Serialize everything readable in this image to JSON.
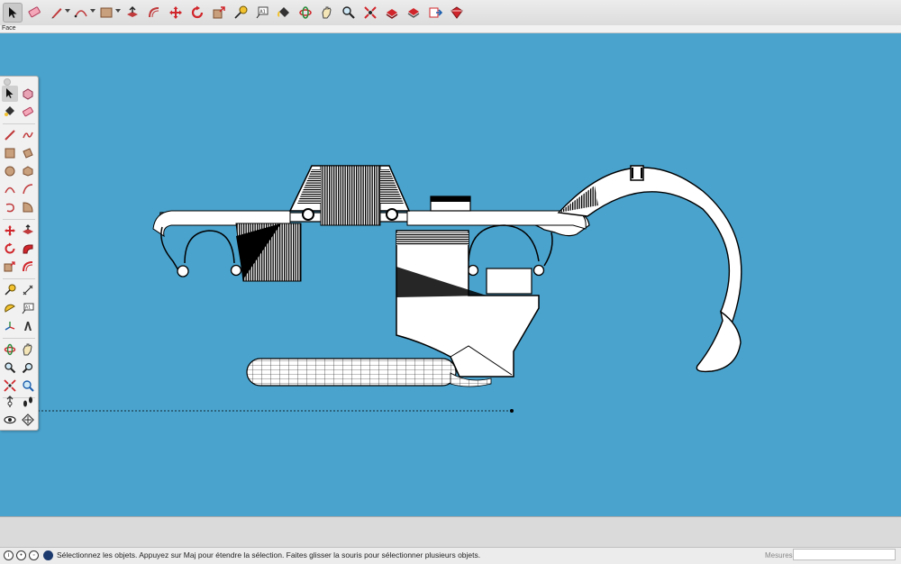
{
  "scene": {
    "tab_label": "Face"
  },
  "toolbar": {
    "buttons": [
      {
        "name": "select-icon",
        "active": true
      },
      {
        "name": "eraser-icon"
      },
      {
        "name": "pencil-icon",
        "dropdown": true
      },
      {
        "name": "arc-icon",
        "dropdown": true
      },
      {
        "name": "rectangle-icon",
        "dropdown": true
      },
      {
        "name": "push-pull-icon"
      },
      {
        "name": "offset-icon"
      },
      {
        "name": "move-icon"
      },
      {
        "name": "rotate-icon"
      },
      {
        "name": "scale-icon"
      },
      {
        "name": "tape-measure-icon"
      },
      {
        "name": "text-icon"
      },
      {
        "name": "paint-bucket-icon"
      },
      {
        "name": "orbit-icon"
      },
      {
        "name": "pan-icon"
      },
      {
        "name": "zoom-icon"
      },
      {
        "name": "zoom-extents-icon"
      },
      {
        "name": "warehouse-icon"
      },
      {
        "name": "extension-warehouse-icon"
      },
      {
        "name": "send-to-layout-icon"
      },
      {
        "name": "extension-manager-icon"
      }
    ]
  },
  "palette": {
    "buttons": [
      [
        "select-icon",
        "make-component-icon"
      ],
      [
        "paint-bucket-icon",
        "eraser-icon"
      ],
      [
        "line-icon",
        "freehand-icon"
      ],
      [
        "rectangle-icon",
        "rotated-rectangle-icon"
      ],
      [
        "circle-icon",
        "polygon-icon"
      ],
      [
        "arc-icon",
        "two-point-arc-icon"
      ],
      [
        "three-point-arc-icon",
        "pie-icon"
      ],
      [
        "move-icon",
        "push-pull-icon"
      ],
      [
        "rotate-icon",
        "follow-me-icon"
      ],
      [
        "scale-icon",
        "offset-icon"
      ],
      [
        "tape-measure-icon",
        "dimension-icon"
      ],
      [
        "protractor-icon",
        "text-icon"
      ],
      [
        "axes-icon",
        "3d-text-icon"
      ],
      [
        "orbit-icon",
        "pan-icon"
      ],
      [
        "zoom-icon",
        "zoom-window-icon"
      ],
      [
        "zoom-extents-icon",
        "previous-view-icon"
      ],
      [
        "position-camera-icon",
        "walk-icon"
      ],
      [
        "look-around-icon",
        "section-plane-icon"
      ]
    ]
  },
  "status": {
    "message": "Sélectionnez les objets. Appuyez sur Maj pour étendre la sélection. Faites glisser la souris pour sélectionner plusieurs objets.",
    "measurements_label": "Mesures",
    "measurements_value": ""
  },
  "colors": {
    "viewport_background": "#4aa3cd",
    "model_fill": "#ffffff",
    "model_edges": "#000000"
  }
}
